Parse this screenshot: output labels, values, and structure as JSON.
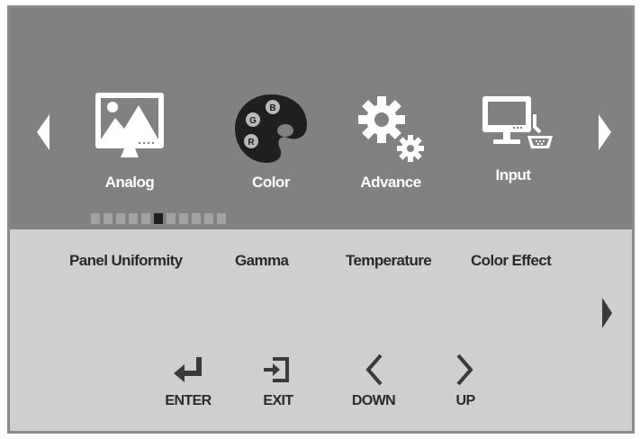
{
  "main_menu": {
    "items": [
      {
        "label": "Analog",
        "icon": "picture-monitor-icon"
      },
      {
        "label": "Color",
        "icon": "palette-icon"
      },
      {
        "label": "Advance",
        "icon": "gears-icon"
      },
      {
        "label": "Input",
        "icon": "computer-input-icon"
      }
    ],
    "page_indicator": {
      "total": 11,
      "active_index": 5
    }
  },
  "submenu": {
    "items": [
      "Panel Uniformity",
      "Gamma",
      "Temperature",
      "Color Effect"
    ]
  },
  "controls": {
    "enter": "ENTER",
    "exit": "EXIT",
    "down": "DOWN",
    "up": "UP"
  },
  "colors": {
    "top_panel": "#818181",
    "bottom_panel": "#cfcfcf",
    "icon_white": "#ffffff",
    "text_dark": "#2a2a2a",
    "active_dot": "#1e1e1e"
  }
}
